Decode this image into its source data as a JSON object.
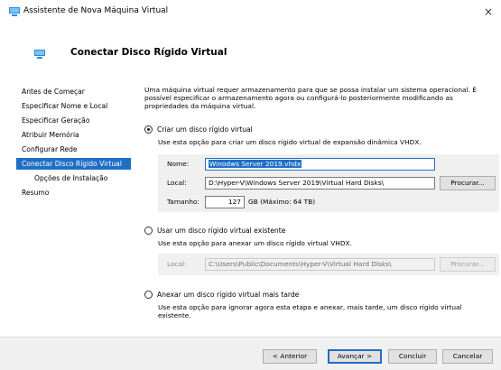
{
  "window": {
    "title": "Assistente de Nova Máquina Virtual",
    "close_glyph": "×"
  },
  "header": {
    "title": "Conectar Disco Rígido Virtual"
  },
  "sidebar": {
    "items": [
      {
        "label": "Antes de Começar"
      },
      {
        "label": "Especificar Nome e Local"
      },
      {
        "label": "Especificar Geração"
      },
      {
        "label": "Atribuir Memória"
      },
      {
        "label": "Configurar Rede"
      },
      {
        "label": "Conectar Disco Rígido Virtual"
      },
      {
        "label": "Opções de Instalação"
      },
      {
        "label": "Resumo"
      }
    ],
    "active_index": 5
  },
  "main": {
    "description": "Uma máquina virtual requer armazenamento para que se possa instalar um sistema operacional. É possível especificar o armazenamento agora ou configurá-lo posteriormente modificando as propriedades da máquina virtual.",
    "option_create": {
      "label": "Criar um disco rígido virtual",
      "hint": "Use esta opção para criar um disco rígido virtual de expansão dinâmica VHDX.",
      "checked": true,
      "name_label": "Nome:",
      "name_value": "Winodws Server 2019.vhdx",
      "location_label": "Local:",
      "location_value": "D:\\Hyper-V\\Windows Server 2019\\Virtual Hard Disks\\",
      "browse_label": "Procurar...",
      "size_label": "Tamanho:",
      "size_value": "127",
      "size_unit": "GB (Máximo: 64 TB)"
    },
    "option_existing": {
      "label": "Usar um disco rígido virtual existente",
      "hint": "Use esta opção para anexar um disco rígido virtual VHDX.",
      "checked": false,
      "location_label": "Local:",
      "location_value": "C:\\Users\\Public\\Documents\\Hyper-V\\Virtual Hard Disks\\",
      "browse_label": "Procurar..."
    },
    "option_later": {
      "label": "Anexar um disco rígido virtual mais tarde",
      "hint": "Use esta opção para ignorar agora esta etapa e anexar, mais tarde, um disco rígido virtual existente.",
      "checked": false
    }
  },
  "footer": {
    "previous_label": "< Anterior",
    "next_label": "Avançar >",
    "finish_label": "Concluir",
    "cancel_label": "Cancelar"
  },
  "colors": {
    "accent": "#1f6fc5",
    "group_background": "#f0f0f0"
  }
}
